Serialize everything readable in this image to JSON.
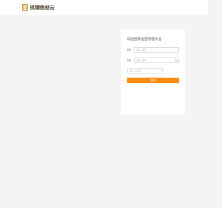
{
  "header": {
    "brand": "杭钢信创云"
  },
  "login": {
    "title": "欢迎登录运营管理平台",
    "account_label": "账号",
    "account_placeholder": "请输入账号",
    "password_label": "密码",
    "password_placeholder": "请输入密码",
    "captcha_placeholder": "请输入验证码",
    "submit_label": "登录"
  },
  "colors": {
    "background": "#f4f4f4",
    "accent": "#ff8a12",
    "brand_gold": "#c79c3a"
  },
  "icons": [
    "logo-icon",
    "eye-icon"
  ]
}
